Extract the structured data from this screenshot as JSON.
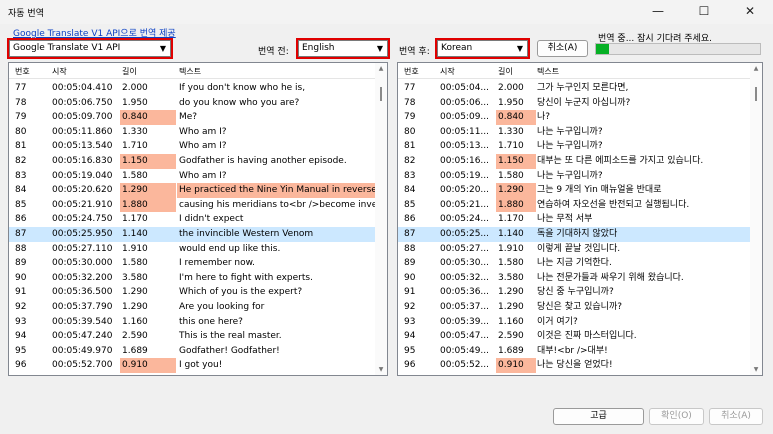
{
  "window": {
    "title": "자동 번역",
    "minimize_glyph": "—",
    "maximize_glyph": "☐",
    "close_glyph": "✕"
  },
  "api_link": "Google Translate V1 API으로 번역 제공",
  "engine_select": {
    "value": "Google Translate V1 API"
  },
  "source_lang": {
    "label": "번역 전:",
    "value": "English"
  },
  "target_lang": {
    "label": "번역 후:",
    "value": "Korean"
  },
  "cancel_top_label": "취소(A)",
  "status_text": "번역 중... 잠시 기다려 주세요.",
  "progress_fraction": 0.08,
  "columns": {
    "num": "번호",
    "start": "시작",
    "length": "길이",
    "text": "텍스트"
  },
  "rows": [
    {
      "num": "77",
      "start": "00:05:04.410",
      "start_short": "00:05:04...",
      "len": "2.000",
      "en": "If you don't know who he is,",
      "ko": "그가 누구인지 모른다면,",
      "hl_len": false,
      "hl_text": false
    },
    {
      "num": "78",
      "start": "00:05:06.750",
      "start_short": "00:05:06...",
      "len": "1.950",
      "en": "do you know who you are?",
      "ko": "당신이 누군지 아십니까?",
      "hl_len": false,
      "hl_text": false
    },
    {
      "num": "79",
      "start": "00:05:09.700",
      "start_short": "00:05:09...",
      "len": "0.840",
      "en": "Me?",
      "ko": "나?",
      "hl_len": true,
      "hl_text": false
    },
    {
      "num": "80",
      "start": "00:05:11.860",
      "start_short": "00:05:11...",
      "len": "1.330",
      "en": "Who am I?",
      "ko": "나는 누구입니까?",
      "hl_len": false,
      "hl_text": false
    },
    {
      "num": "81",
      "start": "00:05:13.540",
      "start_short": "00:05:13...",
      "len": "1.710",
      "en": "Who am I?",
      "ko": "나는 누구입니까?",
      "hl_len": false,
      "hl_text": false
    },
    {
      "num": "82",
      "start": "00:05:16.830",
      "start_short": "00:05:16...",
      "len": "1.150",
      "en": "Godfather is having another episode.",
      "ko": "대부는 또 다른 에피소드를 가지고 있습니다.",
      "hl_len": true,
      "hl_text": false
    },
    {
      "num": "83",
      "start": "00:05:19.040",
      "start_short": "00:05:19...",
      "len": "1.580",
      "en": "Who am I?",
      "ko": "나는 누구입니까?",
      "hl_len": false,
      "hl_text": false
    },
    {
      "num": "84",
      "start": "00:05:20.620",
      "start_short": "00:05:20...",
      "len": "1.290",
      "en": "He practiced the Nine Yin Manual in reverse,",
      "ko": "그는 9 개의 Yin 매뉴얼을 반대로",
      "hl_len": true,
      "hl_text": true
    },
    {
      "num": "85",
      "start": "00:05:21.910",
      "start_short": "00:05:21...",
      "len": "1.880",
      "en": "causing his meridians to<br />become inve...",
      "ko": "연습하여 자오선을 반전되고 실행됩니다.",
      "hl_len": true,
      "hl_text": false
    },
    {
      "num": "86",
      "start": "00:05:24.750",
      "start_short": "00:05:24...",
      "len": "1.170",
      "en": "I didn't expect",
      "ko": "나는 무적 서부",
      "hl_len": false,
      "hl_text": false
    },
    {
      "num": "87",
      "start": "00:05:25.950",
      "start_short": "00:05:25...",
      "len": "1.140",
      "en": "the invincible Western Venom",
      "ko": "독을 기대하지 않았다",
      "hl_len": false,
      "hl_text": false,
      "selected": true
    },
    {
      "num": "88",
      "start": "00:05:27.110",
      "start_short": "00:05:27...",
      "len": "1.910",
      "en": "would end up like this.",
      "ko": "이렇게 끝날 것입니다.",
      "hl_len": false,
      "hl_text": false
    },
    {
      "num": "89",
      "start": "00:05:30.000",
      "start_short": "00:05:30...",
      "len": "1.580",
      "en": "I remember now.",
      "ko": "나는 지금 기억한다.",
      "hl_len": false,
      "hl_text": false
    },
    {
      "num": "90",
      "start": "00:05:32.200",
      "start_short": "00:05:32...",
      "len": "3.580",
      "en": "I'm here to fight with experts.",
      "ko": "나는 전문가들과 싸우기 위해 왔습니다.",
      "hl_len": false,
      "hl_text": false
    },
    {
      "num": "91",
      "start": "00:05:36.500",
      "start_short": "00:05:36...",
      "len": "1.290",
      "en": "Which of you is the expert?",
      "ko": "당신 중 누구입니까?",
      "hl_len": false,
      "hl_text": false
    },
    {
      "num": "92",
      "start": "00:05:37.790",
      "start_short": "00:05:37...",
      "len": "1.290",
      "en": "Are you looking for",
      "ko": "당신은 찾고 있습니까?",
      "hl_len": false,
      "hl_text": false
    },
    {
      "num": "93",
      "start": "00:05:39.540",
      "start_short": "00:05:39...",
      "len": "1.160",
      "en": "this one here?",
      "ko": "이거 여기?",
      "hl_len": false,
      "hl_text": false
    },
    {
      "num": "94",
      "start": "00:05:47.240",
      "start_short": "00:05:47...",
      "len": "2.590",
      "en": "This is the real master.",
      "ko": "이것은 진짜 마스터입니다.",
      "hl_len": false,
      "hl_text": false
    },
    {
      "num": "95",
      "start": "00:05:49.970",
      "start_short": "00:05:49...",
      "len": "1.689",
      "en": "Godfather! Godfather!",
      "ko": "대부!<br />대부!",
      "hl_len": false,
      "hl_text": false
    },
    {
      "num": "96",
      "start": "00:05:52.700",
      "start_short": "00:05:52...",
      "len": "0.910",
      "en": "I got you!",
      "ko": "나는 당신을 얻었다!",
      "hl_len": true,
      "hl_text": false
    }
  ],
  "footer": {
    "advanced": "고급",
    "ok": "확인(O)",
    "cancel": "취소(A)"
  },
  "colors": {
    "highlight": "#fbb79c",
    "selected": "#cce8ff",
    "red_outline": "#e00000",
    "progress": "#06b025"
  }
}
